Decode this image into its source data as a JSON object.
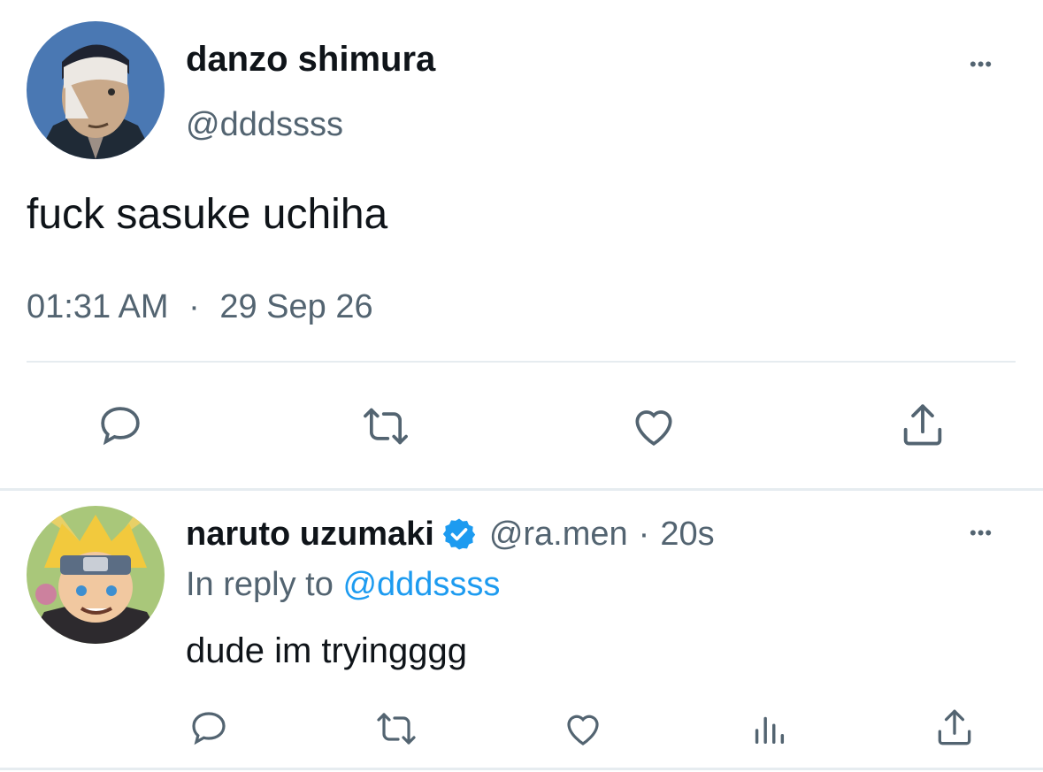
{
  "tweet": {
    "author_name": "danzo shimura",
    "author_handle": "@dddssss",
    "text": "fuck sasuke uchiha",
    "time": "01:31 AM",
    "dot": "·",
    "date": "29 Sep 26",
    "more": "•••",
    "actions": [
      "reply-icon",
      "retweet-icon",
      "like-icon",
      "share-icon"
    ]
  },
  "reply": {
    "author_name": "naruto uzumaki",
    "author_handle": "@ra.men",
    "dot": "·",
    "time": "20s",
    "in_reply_prefix": "In reply to",
    "in_reply_handle": "@dddssss",
    "text": "dude im tryingggg",
    "more": "•••",
    "actions": [
      "reply-icon",
      "retweet-icon",
      "like-icon",
      "views-icon",
      "share-icon"
    ]
  },
  "colors": {
    "text": "#0f1419",
    "muted": "#536471",
    "link": "#1d9bf0",
    "verified": "#1d9bf0",
    "divider": "#e6ecf0"
  }
}
